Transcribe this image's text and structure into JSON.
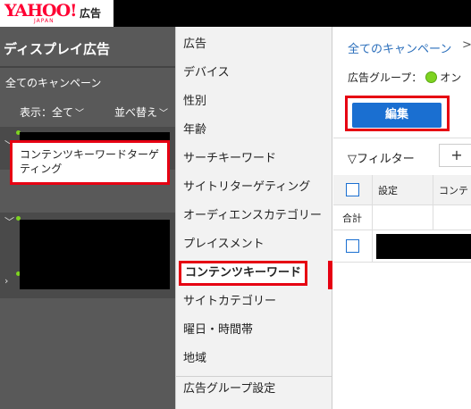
{
  "header": {
    "logo_yahoo": "YAHOO!",
    "logo_japan": "JAPAN",
    "logo_ad": "広告"
  },
  "sidebar": {
    "title": "ディスプレイ広告",
    "all_campaigns": "全てのキャンペーン",
    "display_label": "表示：全て",
    "sort_label": "並べ替え",
    "selected_item": "コンテンツキーワードターゲティング"
  },
  "menu": {
    "items": [
      "広告",
      "デバイス",
      "性別",
      "年齢",
      "サーチキーワード",
      "サイトリターゲティング",
      "オーディエンスカテゴリー",
      "プレイスメント",
      "コンテンツキーワード",
      "サイトカテゴリー",
      "曜日・時間帯",
      "地域",
      "広告グループ設定"
    ],
    "active_index": 8
  },
  "main": {
    "breadcrumb_link": "全てのキャンペーン",
    "breadcrumb_sep": ">",
    "adgroup_label": "広告グループ：",
    "adgroup_status": "オン",
    "edit_button": "編集",
    "filter_label": "フィルター",
    "add_button": "+",
    "table": {
      "col_setting": "設定",
      "col_content": "コンテ",
      "total_label": "合計"
    }
  },
  "colors": {
    "highlight": "#e60012",
    "primary_button": "#1a6fd1",
    "status_on": "#7ed321",
    "link": "#2a6ebb"
  }
}
